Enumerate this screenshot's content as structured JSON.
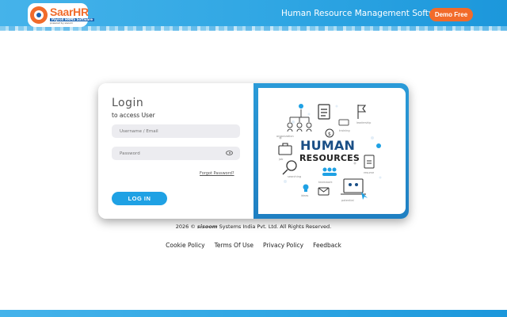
{
  "header": {
    "logo": {
      "name": "SaarHR",
      "tagline": "Payroll HRMS Software",
      "powered": "powered by sisoom"
    },
    "title": "Human Resource Management Software",
    "demo_label": "Demo Free"
  },
  "login": {
    "title": "Login",
    "subtitle": "to access User",
    "username_placeholder": "Username / Email",
    "password_placeholder": "Password",
    "forgot_label": "Forgot Password?",
    "submit_label": "LOG IN"
  },
  "illustration": {
    "headline": "HUMAN",
    "subheadline": "RESOURCES",
    "labels": {
      "organization": "organization",
      "leadership": "leadership",
      "job": "job",
      "searching": "searching",
      "teamwork": "teamwork",
      "resume": "resume",
      "ideas": "ideas",
      "potential": "potential",
      "training": "training"
    }
  },
  "footer": {
    "copyright_prefix": "2026 ©",
    "copyright_brand": "sisoom",
    "copyright_suffix": "Systems India Pvt. Ltd. All Rights Reserved.",
    "links": [
      "Cookie Policy",
      "Terms Of Use",
      "Privacy Policy",
      "Feedback"
    ]
  },
  "colors": {
    "header_blue": "#2fa6e3",
    "accent_orange": "#f26b2a",
    "button_blue": "#1fa1e4",
    "hr_navy": "#1a4f86"
  }
}
